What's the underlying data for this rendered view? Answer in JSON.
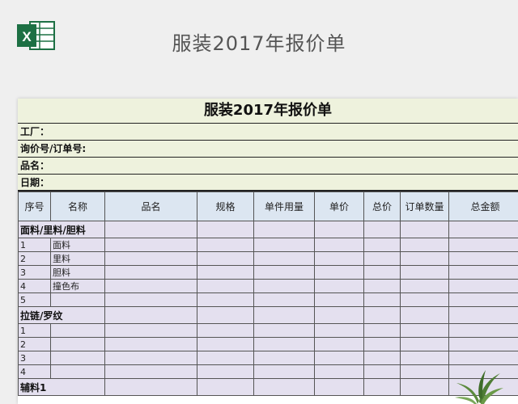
{
  "page_title": "服装2017年报价单",
  "sheet": {
    "title": "服装2017年报价单",
    "info_rows": [
      "工厂：",
      "询价号/订单号:",
      "品名：",
      "日期："
    ],
    "columns": [
      "序号",
      "名称",
      "品名",
      "规格",
      "单件用量",
      "单价",
      "总价",
      "订单数量",
      "总金额"
    ],
    "sections": [
      {
        "label": "面料/里料/胆料",
        "rows": [
          {
            "no": "1",
            "name": "面料"
          },
          {
            "no": "2",
            "name": "里料"
          },
          {
            "no": "3",
            "name": "胆料"
          },
          {
            "no": "4",
            "name": "撞色布"
          },
          {
            "no": "5",
            "name": ""
          }
        ]
      },
      {
        "label": "拉链/罗纹",
        "rows": [
          {
            "no": "1",
            "name": ""
          },
          {
            "no": "2",
            "name": ""
          },
          {
            "no": "3",
            "name": ""
          },
          {
            "no": "4",
            "name": ""
          }
        ]
      },
      {
        "label": "辅料1",
        "rows": []
      }
    ]
  },
  "icons": {
    "logo": "excel-icon",
    "decor": "plant-icon"
  },
  "colors": {
    "excel_green": "#1d7044",
    "info_bg": "#eef2dd",
    "header_bg": "#dce6f1",
    "body_bg": "#e4e0ef"
  }
}
